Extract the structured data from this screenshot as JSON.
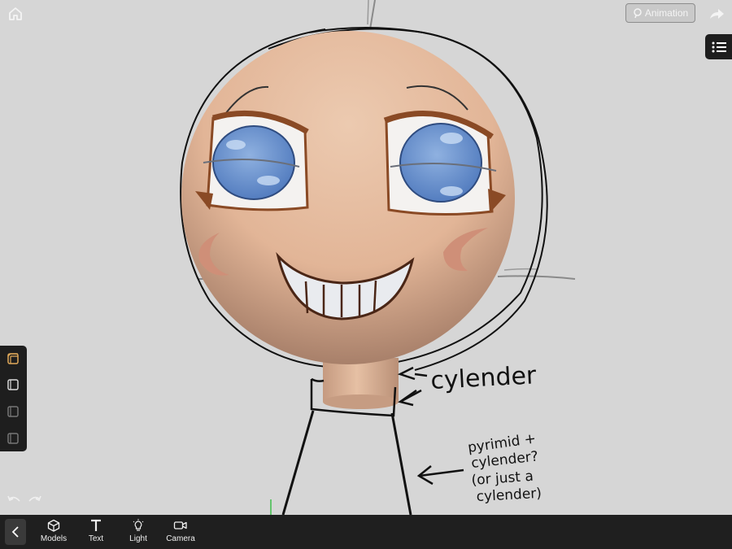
{
  "topbar": {
    "animation_label": "Animation",
    "home_icon": "home-icon",
    "share_icon": "share-arrow-icon"
  },
  "side_menu": {
    "icon": "list-menu-icon"
  },
  "layers": [
    {
      "icon": "cube-layer-icon",
      "active": true
    },
    {
      "icon": "cube-layer-icon",
      "active": false
    },
    {
      "icon": "cube-layer-icon",
      "active": false
    },
    {
      "icon": "cube-layer-icon",
      "active": false
    }
  ],
  "history": {
    "undo_icon": "undo-icon",
    "redo_icon": "redo-icon"
  },
  "toolbar": {
    "back_icon": "chevron-left-icon",
    "tools": [
      {
        "label": "Models",
        "icon": "cube-icon"
      },
      {
        "label": "Text",
        "icon": "text-t-icon"
      },
      {
        "label": "Light",
        "icon": "lightbulb-icon"
      },
      {
        "label": "Camera",
        "icon": "video-camera-icon"
      }
    ]
  },
  "annotations": {
    "neck": "cylender",
    "body_line1": "pyrimid +",
    "body_line2": "cylender?",
    "body_line3": "(or just a",
    "body_line4": "cylender)"
  },
  "colors": {
    "background": "#d6d6d6",
    "panel": "#1e1e1e",
    "skin": "#e7bfa2",
    "iris": "#6d95cf",
    "cheek": "#cf8f78",
    "brow": "#8a4a25",
    "accent_layer": "#e0a95a"
  }
}
